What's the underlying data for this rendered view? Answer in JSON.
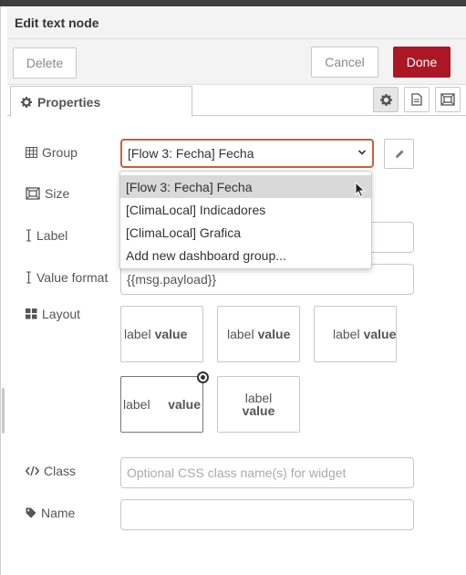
{
  "header": {
    "title": "Edit text node"
  },
  "buttons": {
    "delete": "Delete",
    "cancel": "Cancel",
    "done": "Done"
  },
  "tabs": {
    "properties": "Properties"
  },
  "form": {
    "group": {
      "label": "Group",
      "value": "[Flow 3: Fecha] Fecha",
      "options": [
        "[Flow 3: Fecha] Fecha",
        "[ClimaLocal] Indicadores",
        "[ClimaLocal] Grafica",
        "Add new dashboard group..."
      ]
    },
    "size": {
      "label": "Size"
    },
    "label": {
      "label": "Label",
      "value": ""
    },
    "value_format": {
      "label": "Value format",
      "value": "{{msg.payload}}"
    },
    "layout": {
      "label": "Layout",
      "options": [
        {
          "label": "label",
          "value": "value"
        },
        {
          "label": "label",
          "value": "value"
        },
        {
          "label": "label",
          "value": "value"
        },
        {
          "label": "label",
          "value": "value"
        },
        {
          "label": "label",
          "value": "value"
        }
      ],
      "selected_index": 3
    },
    "class": {
      "label": "Class",
      "placeholder": "Optional CSS class name(s) for widget"
    },
    "name": {
      "label": "Name",
      "value": ""
    }
  },
  "colors": {
    "accent": "#ad1625",
    "focus_border": "#ca5f3a"
  },
  "icons": [
    "gear-icon",
    "description-icon",
    "appearance-icon",
    "table-icon",
    "size-icon",
    "cursor-text-icon",
    "grid-icon",
    "code-icon",
    "tag-icon",
    "pencil-icon",
    "chevron-down-icon",
    "mouse-pointer-icon"
  ]
}
